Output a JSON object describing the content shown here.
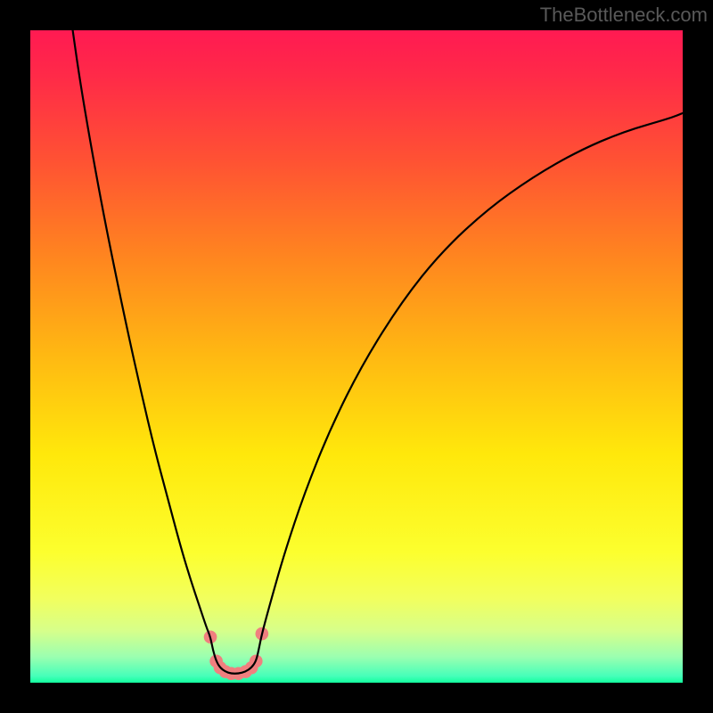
{
  "watermark": "TheBottleneck.com",
  "chart_data": {
    "type": "line",
    "title": "",
    "xlabel": "",
    "ylabel": "",
    "xlim": [
      0,
      100
    ],
    "ylim": [
      0,
      100
    ],
    "background_gradient": {
      "stops": [
        {
          "offset": 0.0,
          "color": "#ff1a52"
        },
        {
          "offset": 0.07,
          "color": "#ff2a48"
        },
        {
          "offset": 0.2,
          "color": "#ff5233"
        },
        {
          "offset": 0.35,
          "color": "#ff861f"
        },
        {
          "offset": 0.5,
          "color": "#ffb912"
        },
        {
          "offset": 0.65,
          "color": "#ffe80b"
        },
        {
          "offset": 0.8,
          "color": "#fcff2e"
        },
        {
          "offset": 0.87,
          "color": "#f2ff5d"
        },
        {
          "offset": 0.92,
          "color": "#d7ff8a"
        },
        {
          "offset": 0.96,
          "color": "#9cffb0"
        },
        {
          "offset": 0.99,
          "color": "#45ffb9"
        },
        {
          "offset": 1.0,
          "color": "#12ff9e"
        }
      ]
    },
    "series": [
      {
        "name": "bottleneck-curve",
        "points": [
          {
            "x": 6.5,
            "y": 100.0
          },
          {
            "x": 7.5,
            "y": 93.0
          },
          {
            "x": 9.0,
            "y": 84.0
          },
          {
            "x": 11.0,
            "y": 73.0
          },
          {
            "x": 13.0,
            "y": 63.0
          },
          {
            "x": 15.0,
            "y": 53.5
          },
          {
            "x": 17.0,
            "y": 44.5
          },
          {
            "x": 19.0,
            "y": 36.0
          },
          {
            "x": 21.0,
            "y": 28.5
          },
          {
            "x": 23.0,
            "y": 21.0
          },
          {
            "x": 24.5,
            "y": 16.0
          },
          {
            "x": 26.0,
            "y": 11.5
          },
          {
            "x": 27.0,
            "y": 8.5
          },
          {
            "x": 27.6,
            "y": 7.0
          },
          {
            "x": 28.0,
            "y": 5.0
          },
          {
            "x": 28.5,
            "y": 3.3
          },
          {
            "x": 29.1,
            "y": 2.3
          },
          {
            "x": 29.9,
            "y": 1.7
          },
          {
            "x": 30.8,
            "y": 1.4
          },
          {
            "x": 31.9,
            "y": 1.4
          },
          {
            "x": 33.0,
            "y": 1.7
          },
          {
            "x": 33.9,
            "y": 2.3
          },
          {
            "x": 34.6,
            "y": 3.3
          },
          {
            "x": 35.0,
            "y": 5.0
          },
          {
            "x": 35.5,
            "y": 7.5
          },
          {
            "x": 37.0,
            "y": 13.0
          },
          {
            "x": 39.0,
            "y": 20.0
          },
          {
            "x": 42.0,
            "y": 29.0
          },
          {
            "x": 46.0,
            "y": 39.0
          },
          {
            "x": 51.0,
            "y": 49.0
          },
          {
            "x": 57.0,
            "y": 58.5
          },
          {
            "x": 63.0,
            "y": 66.0
          },
          {
            "x": 70.0,
            "y": 72.5
          },
          {
            "x": 77.0,
            "y": 77.5
          },
          {
            "x": 84.0,
            "y": 81.5
          },
          {
            "x": 91.0,
            "y": 84.5
          },
          {
            "x": 98.0,
            "y": 86.5
          },
          {
            "x": 100.0,
            "y": 87.3
          }
        ]
      }
    ],
    "markers": [
      {
        "x": 27.6,
        "y": 7.0
      },
      {
        "x": 28.5,
        "y": 3.3
      },
      {
        "x": 29.1,
        "y": 2.3
      },
      {
        "x": 29.9,
        "y": 1.7
      },
      {
        "x": 30.8,
        "y": 1.4
      },
      {
        "x": 31.9,
        "y": 1.4
      },
      {
        "x": 33.0,
        "y": 1.7
      },
      {
        "x": 33.9,
        "y": 2.3
      },
      {
        "x": 34.6,
        "y": 3.3
      },
      {
        "x": 35.5,
        "y": 7.5
      }
    ],
    "marker_color": "#f07f7f",
    "curve_color": "#000000"
  }
}
